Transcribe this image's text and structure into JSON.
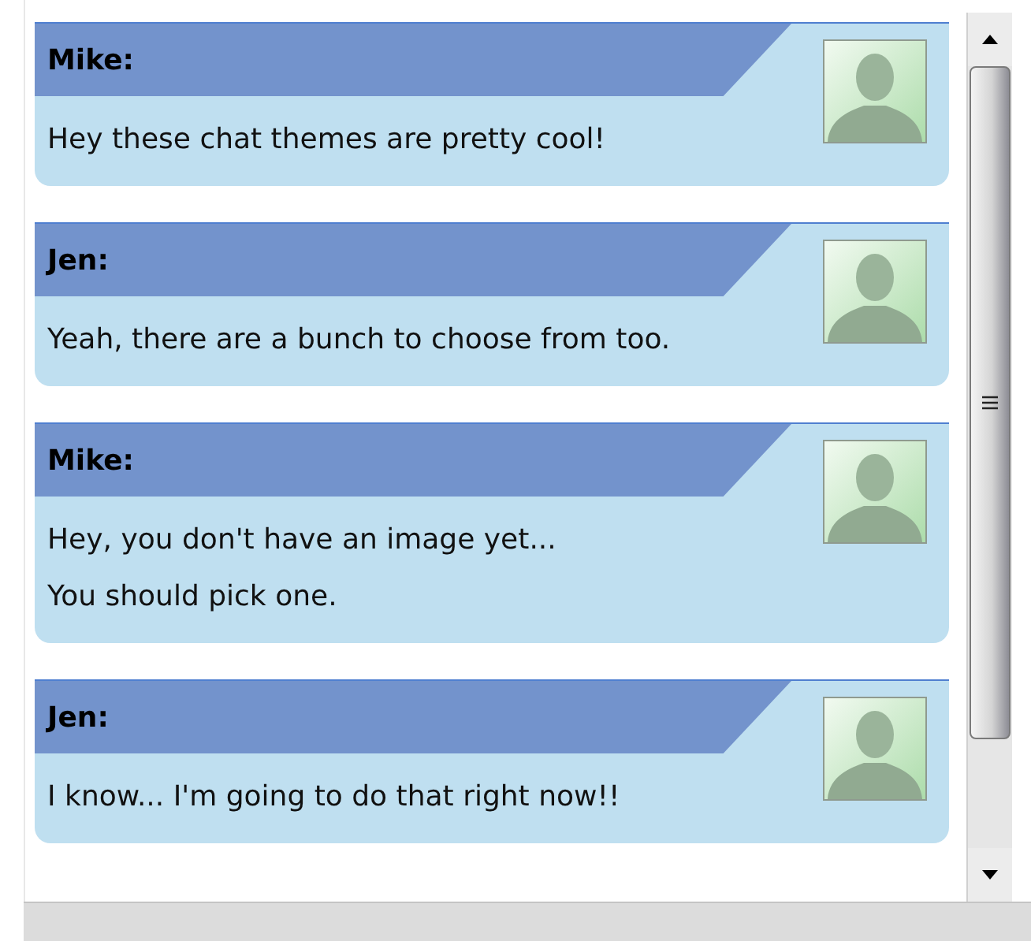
{
  "messages": [
    {
      "sender": "Mike:",
      "lines": [
        "Hey these chat themes are pretty cool!"
      ]
    },
    {
      "sender": "Jen:",
      "lines": [
        "Yeah, there are a bunch to choose from too."
      ]
    },
    {
      "sender": "Mike:",
      "lines": [
        "Hey, you don't have an image yet...",
        "You should pick one."
      ]
    },
    {
      "sender": "Jen:",
      "lines": [
        "I know... I'm going to do that right now!!"
      ]
    }
  ]
}
